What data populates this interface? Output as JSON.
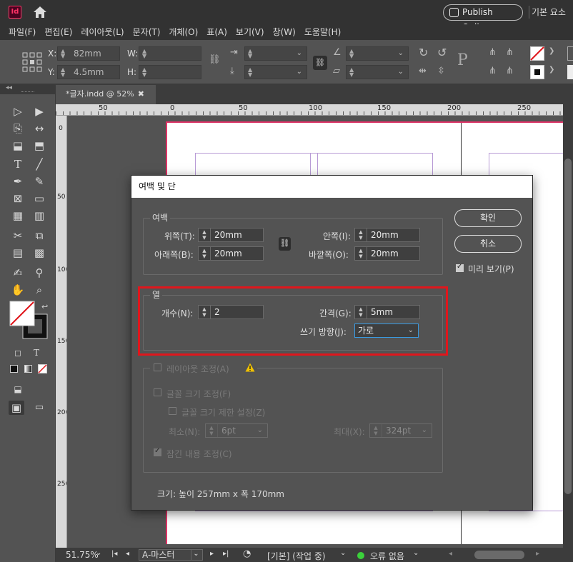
{
  "app": {
    "logo": "Id",
    "publish_label": "Publish Online",
    "workspace": "기본 요소"
  },
  "menu": [
    "파일(F)",
    "편집(E)",
    "레이아웃(L)",
    "문자(T)",
    "개체(O)",
    "표(A)",
    "보기(V)",
    "창(W)",
    "도움말(H)"
  ],
  "control": {
    "x_label": "X:",
    "x_value": "82mm",
    "y_label": "Y:",
    "y_value": "4.5mm",
    "w_label": "W:",
    "h_label": "H:"
  },
  "document": {
    "tab_label": "*글자.indd @ 52%",
    "close": "✖"
  },
  "ruler": {
    "h_ticks": [
      "50",
      "0",
      "50",
      "100",
      "150",
      "200",
      "250"
    ],
    "v_ticks": [
      "0",
      "50",
      "100",
      "150",
      "200",
      "250"
    ]
  },
  "status": {
    "zoom": "51.75%",
    "page": "A-마스터",
    "profile": "[기본] (작업 중)",
    "errors": "오류 없음"
  },
  "dialog": {
    "title": "여백 및 단",
    "margins": {
      "label": "여백",
      "top_label": "위쪽(T):",
      "top_value": "20mm",
      "bottom_label": "아래쪽(B):",
      "bottom_value": "20mm",
      "inside_label": "안쪽(I):",
      "inside_value": "20mm",
      "outside_label": "바깥쪽(O):",
      "outside_value": "20mm"
    },
    "columns": {
      "label": "열",
      "number_label": "개수(N):",
      "number_value": "2",
      "gutter_label": "간격(G):",
      "gutter_value": "5mm",
      "direction_label": "쓰기 방향(J):",
      "direction_value": "가로"
    },
    "layout_adjust": {
      "label": "레이아웃 조정(A)",
      "font_size_label": "글꼴 크기 조정(F)",
      "font_limit_label": "글꼴 크기 제한 설정(Z)",
      "min_label": "최소(N):",
      "min_value": "6pt",
      "max_label": "최대(X):",
      "max_value": "324pt",
      "locked_label": "잠긴 내용 조정(C)"
    },
    "ok_label": "확인",
    "cancel_label": "취소",
    "preview_label": "미리 보기(P)",
    "size_text": "크기:  높이 257mm x 폭 170mm"
  },
  "colors": {
    "highlight": "#e0161c",
    "accent": "#3a9ae0"
  }
}
